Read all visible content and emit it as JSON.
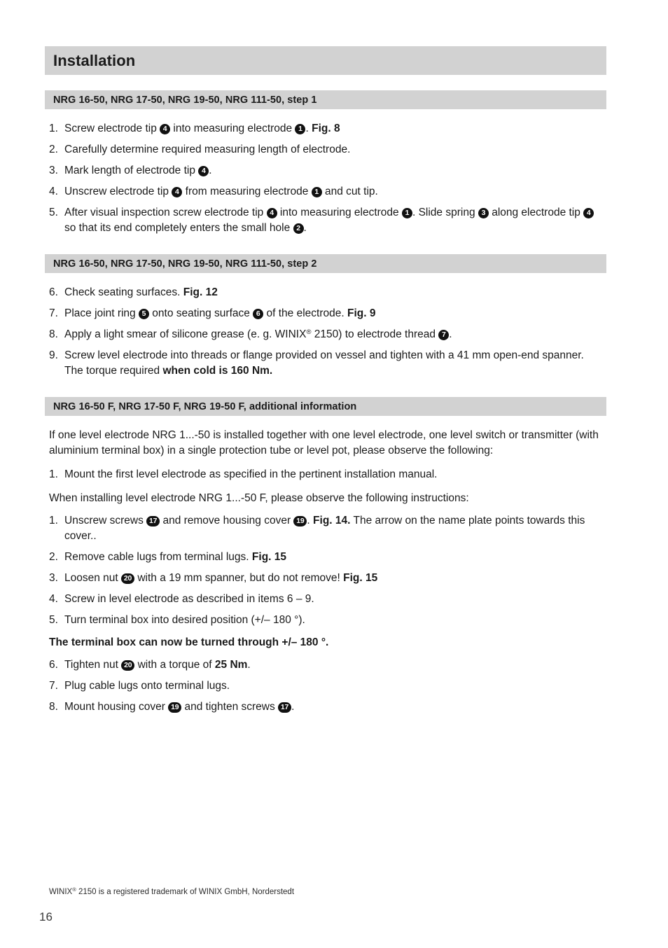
{
  "document": {
    "title": "Installation",
    "page_number": "16",
    "footnote_prefix": "WINIX",
    "footnote_registered": "®",
    "footnote_suffix": " 2150 is a registered trademark of WINIX GmbH, Norderstedt",
    "bar_color": "#d2d2d2",
    "text_color": "#1a1a1a"
  },
  "sections": [
    {
      "heading": "NRG 16-50, NRG 17-50, NRG 19-50, NRG 111-50, step 1",
      "items": [
        {
          "number": "1.",
          "parts": [
            {
              "t": "text",
              "v": "Screw electrode tip "
            },
            {
              "t": "badge",
              "v": "4"
            },
            {
              "t": "text",
              "v": " into measuring electrode "
            },
            {
              "t": "badge",
              "v": "1"
            },
            {
              "t": "text",
              "v": ". "
            },
            {
              "t": "bold",
              "v": "Fig. 8"
            }
          ]
        },
        {
          "number": "2.",
          "parts": [
            {
              "t": "text",
              "v": "Carefully determine required measuring length of electrode."
            }
          ]
        },
        {
          "number": "3.",
          "parts": [
            {
              "t": "text",
              "v": "Mark length of electrode tip "
            },
            {
              "t": "badge",
              "v": "4"
            },
            {
              "t": "text",
              "v": "."
            }
          ]
        },
        {
          "number": "4.",
          "parts": [
            {
              "t": "text",
              "v": "Unscrew electrode tip "
            },
            {
              "t": "badge",
              "v": "4"
            },
            {
              "t": "text",
              "v": " from measuring electrode "
            },
            {
              "t": "badge",
              "v": "1"
            },
            {
              "t": "text",
              "v": " and cut tip."
            }
          ]
        },
        {
          "number": "5.",
          "parts": [
            {
              "t": "text",
              "v": "After visual inspection screw electrode tip "
            },
            {
              "t": "badge",
              "v": "4"
            },
            {
              "t": "text",
              "v": " into measuring electrode "
            },
            {
              "t": "badge",
              "v": "1"
            },
            {
              "t": "text",
              "v": ". Slide spring "
            },
            {
              "t": "badge",
              "v": "3"
            },
            {
              "t": "text",
              "v": " along electrode tip "
            },
            {
              "t": "badge",
              "v": "4"
            },
            {
              "t": "text",
              "v": " so that its end completely enters the small hole "
            },
            {
              "t": "badge",
              "v": "2"
            },
            {
              "t": "text",
              "v": "."
            }
          ]
        }
      ]
    },
    {
      "heading": "NRG 16-50, NRG 17-50, NRG 19-50, NRG 111-50, step 2",
      "items": [
        {
          "number": "6.",
          "parts": [
            {
              "t": "text",
              "v": "Check seating surfaces. "
            },
            {
              "t": "bold",
              "v": "Fig. 12"
            }
          ]
        },
        {
          "number": "7.",
          "parts": [
            {
              "t": "text",
              "v": "Place joint ring "
            },
            {
              "t": "badge",
              "v": "5"
            },
            {
              "t": "text",
              "v": " onto seating surface "
            },
            {
              "t": "badge",
              "v": "6"
            },
            {
              "t": "text",
              "v": " of the electrode. "
            },
            {
              "t": "bold",
              "v": "Fig. 9"
            }
          ]
        },
        {
          "number": "8.",
          "parts": [
            {
              "t": "text",
              "v": "Apply a light smear of silicone grease (e. g. WINIX"
            },
            {
              "t": "sup",
              "v": "®"
            },
            {
              "t": "text",
              "v": " 2150) to electrode thread "
            },
            {
              "t": "badge",
              "v": "7"
            },
            {
              "t": "text",
              "v": "."
            }
          ]
        },
        {
          "number": "9.",
          "parts": [
            {
              "t": "text",
              "v": "Screw level electrode into threads or flange provided on vessel and tighten with a 41 mm open-end spanner."
            },
            {
              "t": "break",
              "v": ""
            },
            {
              "t": "text",
              "v": "The torque required "
            },
            {
              "t": "bold",
              "v": "when cold is 160 Nm."
            }
          ]
        }
      ]
    }
  ],
  "additional": {
    "heading": "NRG 16-50 F, NRG 17-50 F, NRG 19-50 F, additional information",
    "intro_paragraph": "If one level electrode NRG 1...-50 is installed together with one level electrode, one level switch or transmitter (with aluminium terminal box) in a single protection tube or level pot, please observe the following:",
    "first_list": [
      {
        "number": "1.",
        "parts": [
          {
            "t": "text",
            "v": "Mount the first level electrode as specified in the pertinent installation manual."
          }
        ]
      }
    ],
    "second_intro": "When installing level electrode NRG 1...-50 F, please observe the following instructions:",
    "second_list_part_a": [
      {
        "number": "1.",
        "parts": [
          {
            "t": "text",
            "v": "Unscrew screws "
          },
          {
            "t": "badge",
            "v": "17"
          },
          {
            "t": "text",
            "v": " and remove housing cover "
          },
          {
            "t": "badge",
            "v": "19"
          },
          {
            "t": "text",
            "v": ". "
          },
          {
            "t": "bold",
            "v": "Fig. 14."
          },
          {
            "t": "text",
            "v": " The arrow on the name plate points towards this cover.."
          }
        ]
      },
      {
        "number": "2.",
        "parts": [
          {
            "t": "text",
            "v": "Remove cable lugs from terminal lugs. "
          },
          {
            "t": "bold",
            "v": "Fig. 15"
          }
        ]
      },
      {
        "number": "3.",
        "parts": [
          {
            "t": "text",
            "v": "Loosen nut "
          },
          {
            "t": "badge",
            "v": "20"
          },
          {
            "t": "text",
            "v": " with a 19 mm spanner, but do not remove! "
          },
          {
            "t": "bold",
            "v": "Fig. 15"
          }
        ]
      },
      {
        "number": "4.",
        "parts": [
          {
            "t": "text",
            "v": "Screw in level electrode as described in items 6 – 9."
          }
        ]
      },
      {
        "number": "5.",
        "parts": [
          {
            "t": "text",
            "v": "Turn terminal box into desired position (+/– 180 °)."
          }
        ]
      }
    ],
    "bold_note": "The terminal box can now be turned through +/– 180 °.",
    "second_list_part_b": [
      {
        "number": "6.",
        "parts": [
          {
            "t": "text",
            "v": "Tighten nut "
          },
          {
            "t": "badge",
            "v": "20"
          },
          {
            "t": "text",
            "v": " with a torque of "
          },
          {
            "t": "bold",
            "v": "25 Nm"
          },
          {
            "t": "text",
            "v": "."
          }
        ]
      },
      {
        "number": "7.",
        "parts": [
          {
            "t": "text",
            "v": "Plug cable lugs onto terminal lugs."
          }
        ]
      },
      {
        "number": "8.",
        "parts": [
          {
            "t": "text",
            "v": "Mount housing cover "
          },
          {
            "t": "badge",
            "v": "19"
          },
          {
            "t": "text",
            "v": " and tighten screws "
          },
          {
            "t": "badge",
            "v": "17"
          },
          {
            "t": "text",
            "v": "."
          }
        ]
      }
    ]
  }
}
